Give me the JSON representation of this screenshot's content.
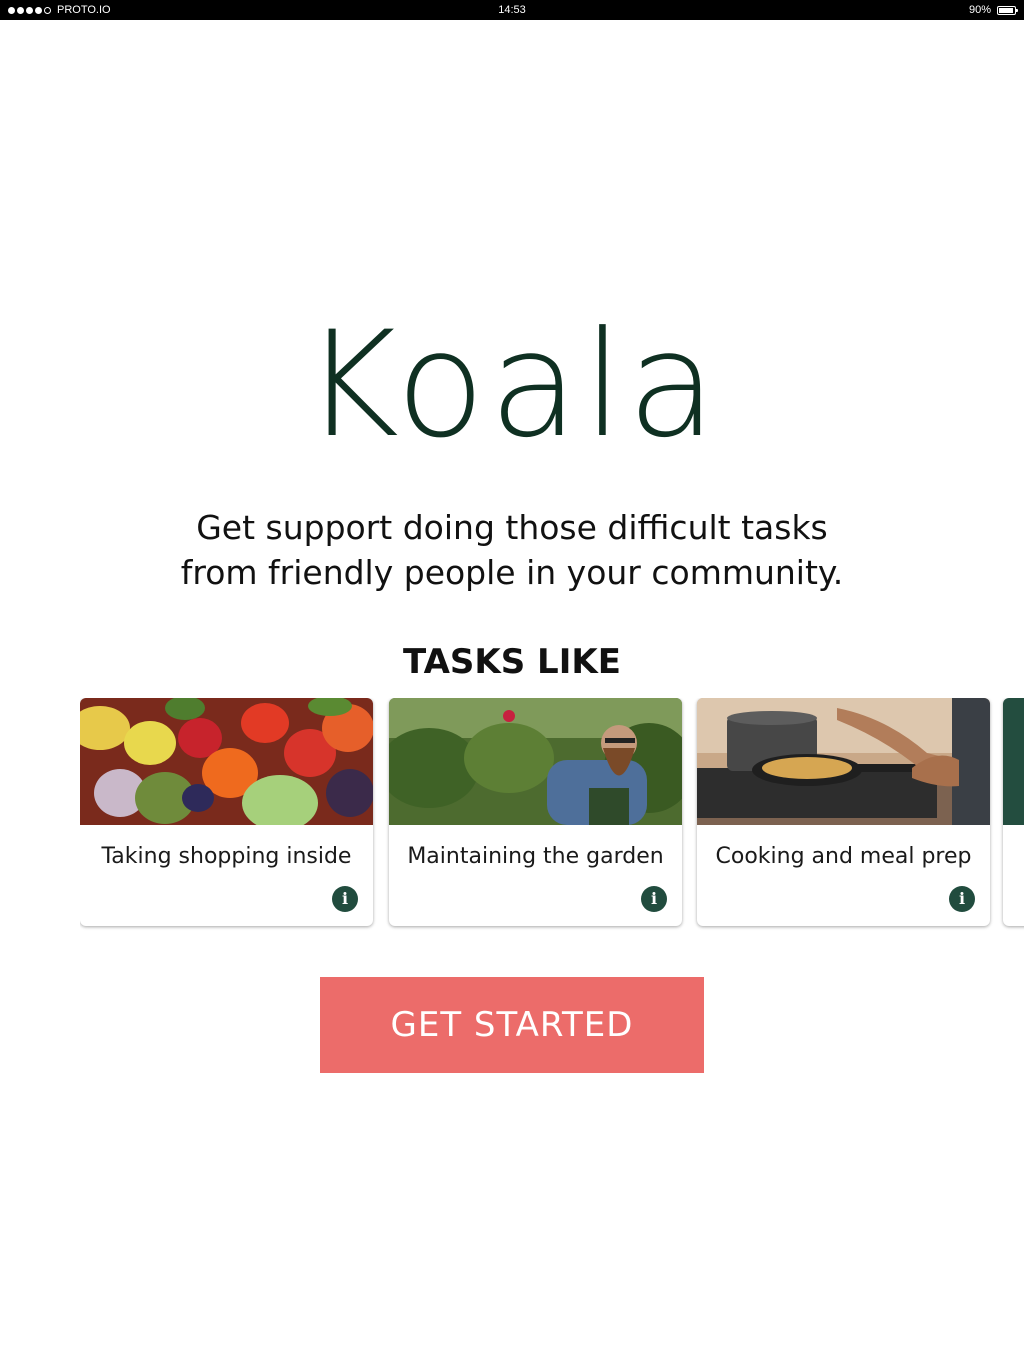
{
  "status_bar": {
    "carrier": "PROTO.IO",
    "time": "14:53",
    "battery_percent_text": "90%",
    "battery_level": 0.9,
    "signal_bars_filled": 4,
    "signal_bars_total": 5
  },
  "hero": {
    "brand": "Koala",
    "tagline_line1": "Get support doing those difficult tasks",
    "tagline_line2": "from friendly people in your community."
  },
  "tasks": {
    "title": "TASKS LIKE",
    "items": [
      {
        "label": "Taking shopping inside",
        "image": "fruit-vegetables-photo",
        "icon": "info-icon"
      },
      {
        "label": "Maintaining the garden",
        "image": "gardener-photo",
        "icon": "info-icon"
      },
      {
        "label": "Cooking and meal prep",
        "image": "cooking-photo",
        "icon": "info-icon"
      }
    ]
  },
  "cta": {
    "label": "GET STARTED"
  },
  "colors": {
    "brand": "#0f3022",
    "accent_button": "#ec6c6a",
    "info_icon": "#214c3e",
    "status_bar": "#000000"
  }
}
